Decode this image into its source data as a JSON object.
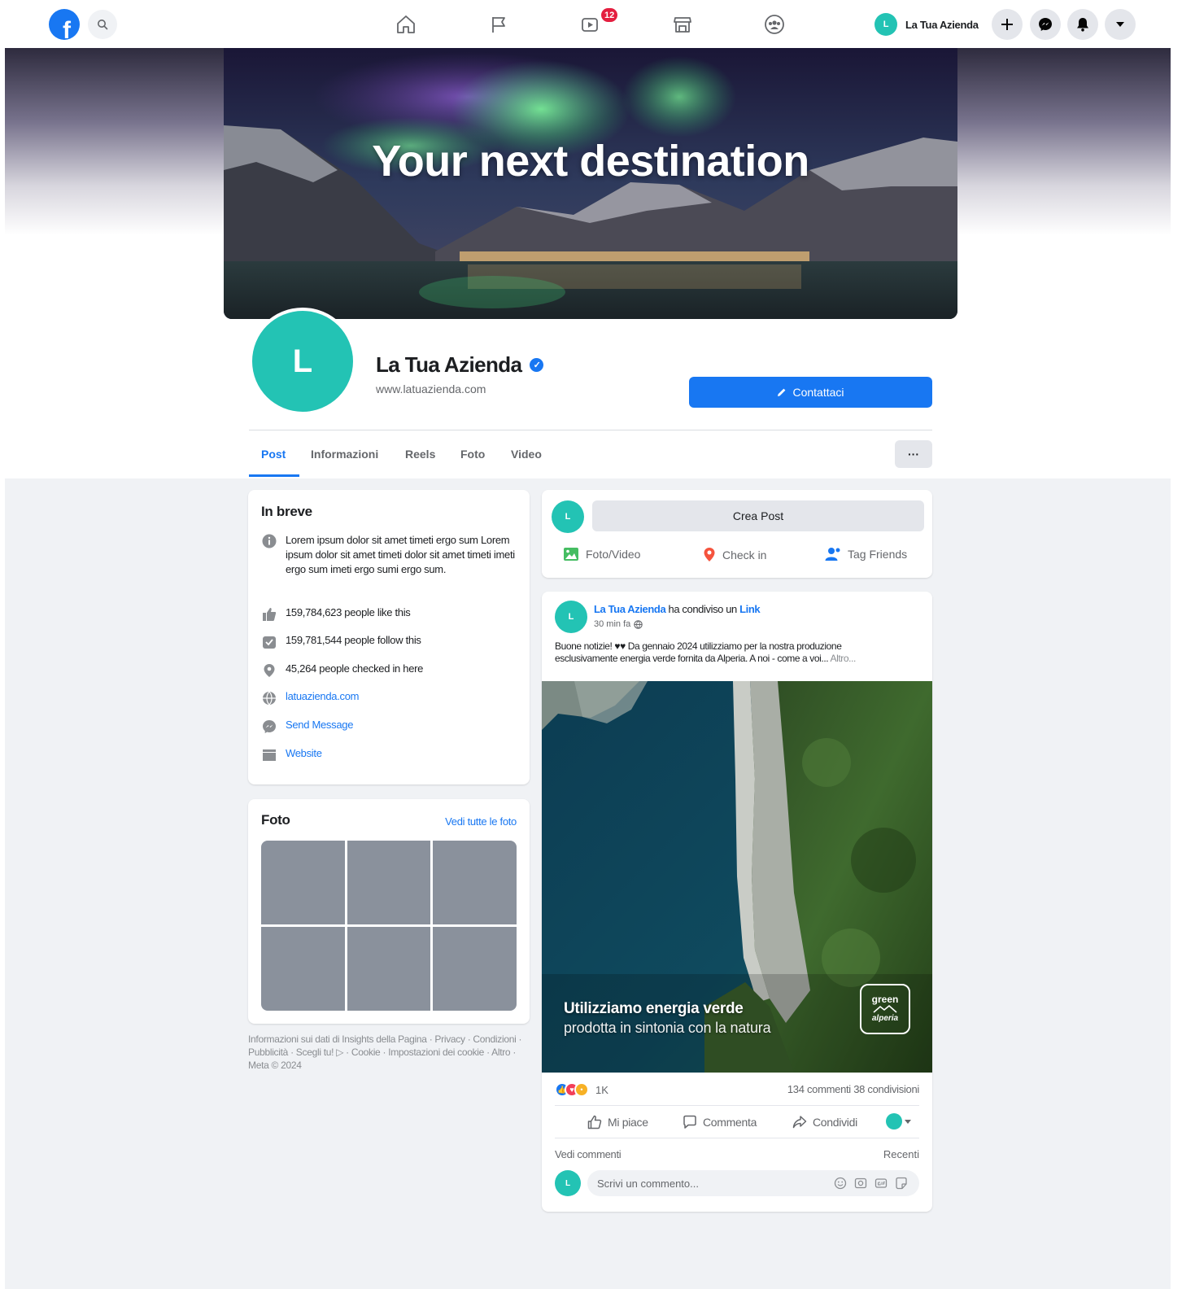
{
  "topnav": {
    "logo_letter": "f",
    "account_name": "La Tua Azienda",
    "account_initial": "L",
    "watch_badge": "12",
    "icons": [
      "search-icon",
      "home-icon",
      "flag-icon",
      "video-icon",
      "marketplace-icon",
      "groups-icon",
      "plus-icon",
      "messenger-icon",
      "bell-icon",
      "caret-down-icon"
    ]
  },
  "cover": {
    "title": "Your next destination"
  },
  "page": {
    "initial": "L",
    "name": "La Tua Azienda",
    "url": "www.latuazienda.com",
    "contact_label": "Contattaci"
  },
  "tabs": [
    "Post",
    "Informazioni",
    "Reels",
    "Foto",
    "Video"
  ],
  "more_label": "···",
  "intro": {
    "title": "In breve",
    "description": "Lorem ipsum dolor sit amet timeti ergo sum Lorem ipsum dolor sit amet timeti dolor sit amet timeti imeti ergo sum imeti ergo sumi ergo sum.",
    "likes": "159,784,623 people like this",
    "follows": "159,781,544 people follow this",
    "checkins": "45,264 people checked in here",
    "website_domain": "latuazienda.com",
    "send_message": "Send Message",
    "website": "Website"
  },
  "photos": {
    "title": "Foto",
    "see_all": "Vedi tutte le foto"
  },
  "footer": {
    "text": "Informazioni sui dati di Insights della Pagina · Privacy · Condizioni · Pubblicità · Scegli tu! ▷ · Cookie · Impostazioni dei cookie · Altro · Meta © 2024"
  },
  "composer": {
    "initial": "L",
    "create_post": "Crea Post",
    "photo_video": "Foto/Video",
    "check_in": "Check in",
    "tag_friends": "Tag Friends"
  },
  "post": {
    "initial": "L",
    "author": "La Tua Azienda",
    "shared_text": "ha condiviso un",
    "link_label": "Link",
    "time": "30 min fa",
    "text": "Buone notizie! ♥♥ Da gennaio 2024 utilizziamo per la nostra produzione esclusivamente energia verde fornita da Alperia. A noi - come a voi...",
    "more": "Altro...",
    "image_caption_line1": "Utilizziamo energia verde",
    "image_caption_line2": "prodotta in sintonia con la natura",
    "logo_line1": "green",
    "logo_line2": "alperia",
    "reactions_count": "1K",
    "comments_count": "134 commenti",
    "shares_count": "38 condivisioni",
    "like_label": "Mi piace",
    "comment_label": "Commenta",
    "share_label": "Condividi",
    "see_comments": "Vedi commenti",
    "sort_label": "Recenti",
    "comment_placeholder": "Scrivi un commento..."
  },
  "colors": {
    "brand": "#1877f2",
    "avatar": "#23c3b4",
    "page_bg": "#f0f2f5"
  }
}
